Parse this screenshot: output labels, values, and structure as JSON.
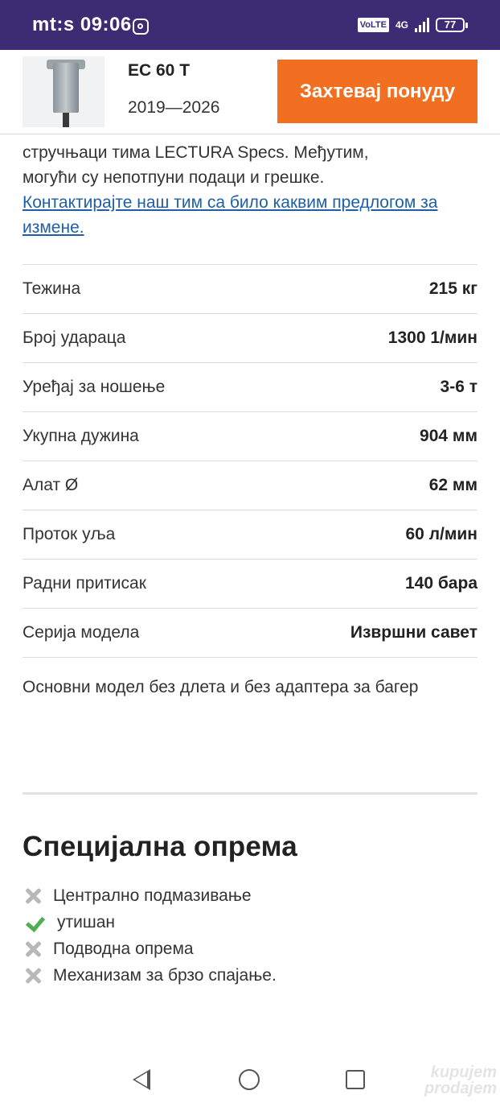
{
  "status_bar": {
    "carrier_time": "mt:s 09:06",
    "volte": "VoLTE",
    "network": "4G",
    "battery": "77"
  },
  "header": {
    "model": "EC 60 T",
    "years": "2019—2026",
    "cta_label": "Захтевај понуду"
  },
  "intro": {
    "partial_line": "стручњаци тима LECTURA Specs. Међутим, могући су непотпуни подаци и грешке.",
    "line1": "стручњаци тима LECTURA Specs. Међутим,",
    "line2": "могући су непотпуни подаци и грешке.",
    "link": "Контактирајте наш тим са било каквим предлогом за измене."
  },
  "specs": [
    {
      "label": "Тежина",
      "value": "215 кг"
    },
    {
      "label": "Број удараца",
      "value": "1300 1/мин"
    },
    {
      "label": "Уређај за ношење",
      "value": "3-6 т"
    },
    {
      "label": "Укупна дужина",
      "value": "904 мм"
    },
    {
      "label": "Алат Ø",
      "value": "62 мм"
    },
    {
      "label": "Проток уља",
      "value": "60 л/мин"
    },
    {
      "label": "Радни притисак",
      "value": "140 бара"
    },
    {
      "label": "Серија модела",
      "value": "Извршни савет"
    }
  ],
  "note": "Основни модел без длета и без адаптера за багер",
  "special_equipment": {
    "title": "Специјална опрема",
    "items": [
      {
        "label": "Централно подмазивање",
        "available": false
      },
      {
        "label": "утишан",
        "available": true
      },
      {
        "label": "Подводна опрема",
        "available": false
      },
      {
        "label": "Механизам за брзо спајање.",
        "available": false
      }
    ]
  },
  "watermark": {
    "line1": "kupujem",
    "line2": "prodajem"
  },
  "colors": {
    "status_bar": "#3d2b74",
    "cta": "#f26f21",
    "link": "#1f5fa5",
    "check": "#4caf50"
  }
}
